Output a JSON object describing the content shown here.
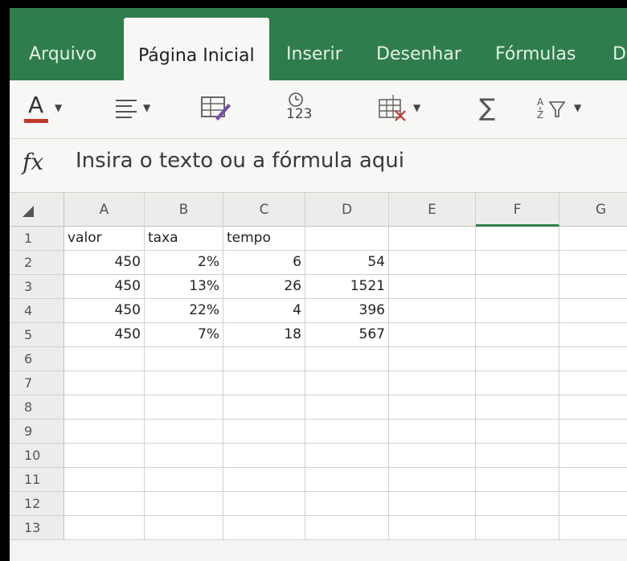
{
  "ribbon": {
    "tabs": [
      {
        "label": "Arquivo",
        "active": false
      },
      {
        "label": "Página Inicial",
        "active": true
      },
      {
        "label": "Inserir",
        "active": false
      },
      {
        "label": "Desenhar",
        "active": false
      },
      {
        "label": "Fórmulas",
        "active": false
      },
      {
        "label": "D",
        "active": false
      }
    ]
  },
  "toolbar": {
    "font_color_letter": "A",
    "number_format_label": "123",
    "sum_symbol": "∑",
    "font_color_hex": "#c0392b"
  },
  "formula_bar": {
    "fx_label": "fx",
    "placeholder": "Insira o texto ou a fórmula aqui"
  },
  "sheet": {
    "columns": [
      "A",
      "B",
      "C",
      "D",
      "E",
      "F",
      "G"
    ],
    "selected_column": "F",
    "rows": [
      {
        "num": "1",
        "cells": [
          "valor",
          "taxa",
          "tempo",
          "",
          "",
          "",
          ""
        ]
      },
      {
        "num": "2",
        "cells": [
          "450",
          "2%",
          "6",
          "54",
          "",
          "",
          ""
        ]
      },
      {
        "num": "3",
        "cells": [
          "450",
          "13%",
          "26",
          "1521",
          "",
          "",
          ""
        ]
      },
      {
        "num": "4",
        "cells": [
          "450",
          "22%",
          "4",
          "396",
          "",
          "",
          ""
        ]
      },
      {
        "num": "5",
        "cells": [
          "450",
          "7%",
          "18",
          "567",
          "",
          "",
          ""
        ]
      },
      {
        "num": "6",
        "cells": [
          "",
          "",
          "",
          "",
          "",
          "",
          ""
        ]
      },
      {
        "num": "7",
        "cells": [
          "",
          "",
          "",
          "",
          "",
          "",
          ""
        ]
      },
      {
        "num": "8",
        "cells": [
          "",
          "",
          "",
          "",
          "",
          "",
          ""
        ]
      },
      {
        "num": "9",
        "cells": [
          "",
          "",
          "",
          "",
          "",
          "",
          ""
        ]
      },
      {
        "num": "10",
        "cells": [
          "",
          "",
          "",
          "",
          "",
          "",
          ""
        ]
      },
      {
        "num": "11",
        "cells": [
          "",
          "",
          "",
          "",
          "",
          "",
          ""
        ]
      },
      {
        "num": "12",
        "cells": [
          "",
          "",
          "",
          "",
          "",
          "",
          ""
        ]
      },
      {
        "num": "13",
        "cells": [
          "",
          "",
          "",
          "",
          "",
          "",
          ""
        ]
      }
    ]
  },
  "colors": {
    "ribbon_green": "#2f7d4c",
    "selection_green": "#2f7d4c"
  }
}
